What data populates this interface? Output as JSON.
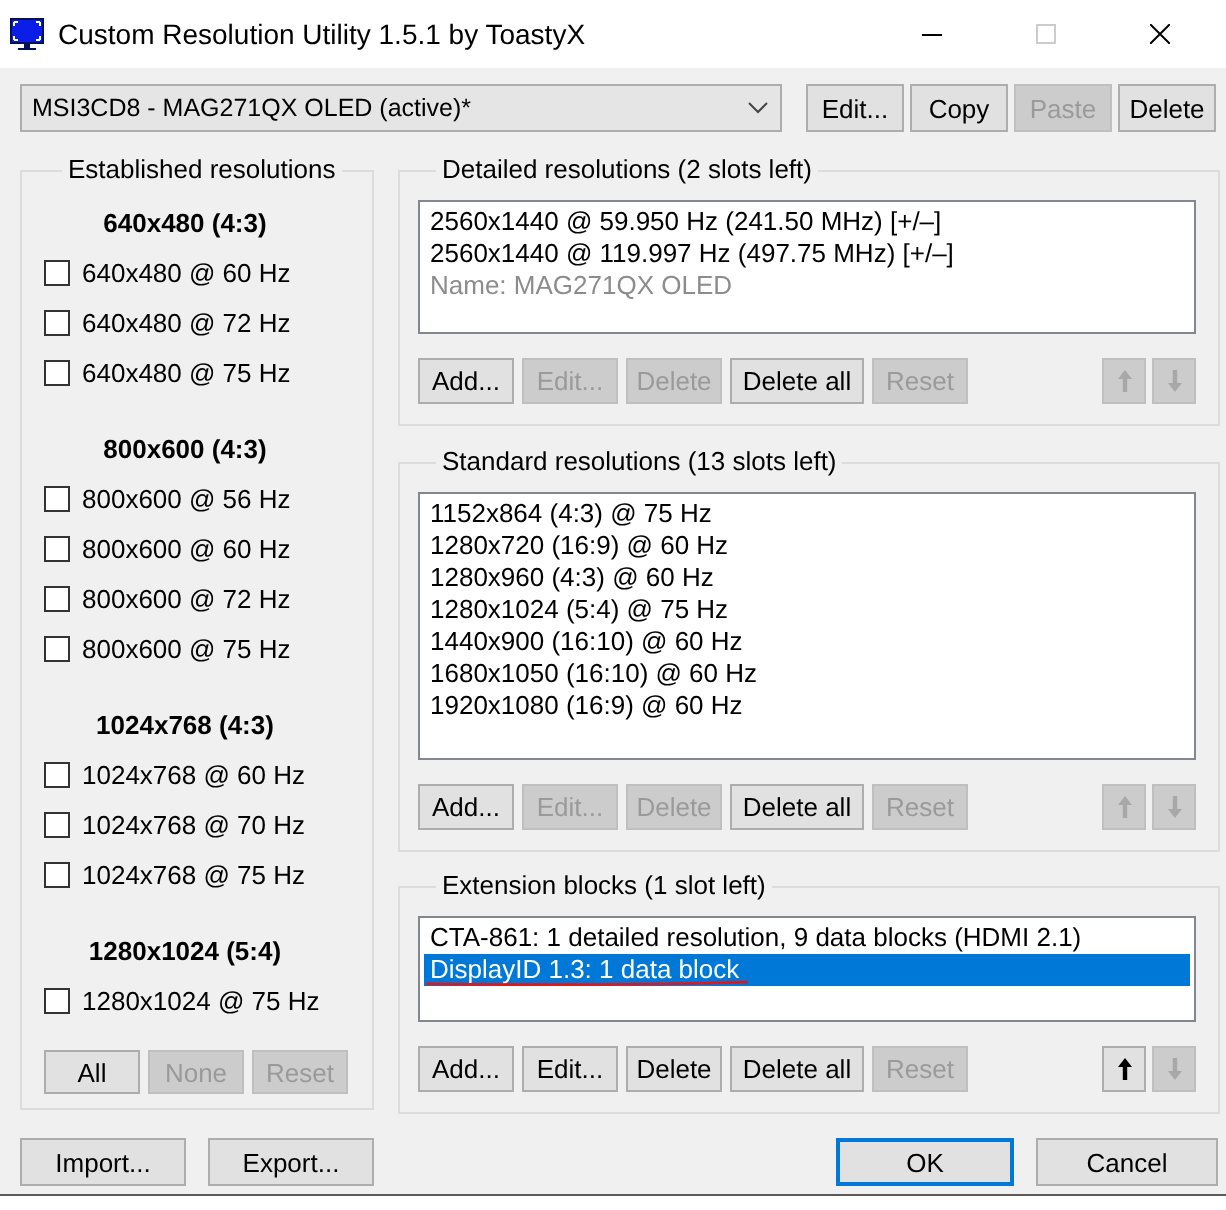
{
  "window": {
    "title": "Custom Resolution Utility 1.5.1 by ToastyX",
    "maximize_disabled": true
  },
  "toolbar": {
    "monitor_dropdown": {
      "value": "MSI3CD8 - MAG271QX OLED (active)*"
    },
    "buttons": [
      {
        "label": "Edit...",
        "disabled": false
      },
      {
        "label": "Copy",
        "disabled": false
      },
      {
        "label": "Paste",
        "disabled": true
      },
      {
        "label": "Delete",
        "disabled": false
      }
    ]
  },
  "established": {
    "title": "Established resolutions",
    "groups": [
      {
        "heading": "640x480 (4:3)",
        "items": [
          {
            "label": "640x480 @ 60 Hz",
            "checked": false
          },
          {
            "label": "640x480 @ 72 Hz",
            "checked": false
          },
          {
            "label": "640x480 @ 75 Hz",
            "checked": false
          }
        ]
      },
      {
        "heading": "800x600 (4:3)",
        "items": [
          {
            "label": "800x600 @ 56 Hz",
            "checked": false
          },
          {
            "label": "800x600 @ 60 Hz",
            "checked": false
          },
          {
            "label": "800x600 @ 72 Hz",
            "checked": false
          },
          {
            "label": "800x600 @ 75 Hz",
            "checked": false
          }
        ]
      },
      {
        "heading": "1024x768 (4:3)",
        "items": [
          {
            "label": "1024x768 @ 60 Hz",
            "checked": false
          },
          {
            "label": "1024x768 @ 70 Hz",
            "checked": false
          },
          {
            "label": "1024x768 @ 75 Hz",
            "checked": false
          }
        ]
      },
      {
        "heading": "1280x1024 (5:4)",
        "items": [
          {
            "label": "1280x1024 @ 75 Hz",
            "checked": false
          }
        ]
      }
    ],
    "buttons": [
      {
        "label": "All",
        "disabled": false
      },
      {
        "label": "None",
        "disabled": true
      },
      {
        "label": "Reset",
        "disabled": true
      }
    ]
  },
  "detailed": {
    "title": "Detailed resolutions (2 slots left)",
    "items": [
      {
        "kind": "timing",
        "text": "2560x1440 @ 59.950 Hz (241.50 MHz) [+/–]",
        "selected": false
      },
      {
        "kind": "timing",
        "text": "2560x1440 @ 119.997 Hz (497.75 MHz) [+/–]",
        "selected": false
      },
      {
        "kind": "name",
        "text": "Name: MAG271QX OLED",
        "selected": false
      }
    ],
    "buttons": [
      {
        "label": "Add...",
        "disabled": false
      },
      {
        "label": "Edit...",
        "disabled": true
      },
      {
        "label": "Delete",
        "disabled": true
      },
      {
        "label": "Delete all",
        "disabled": false
      },
      {
        "label": "Reset",
        "disabled": true
      }
    ],
    "arrows": [
      {
        "kind": "up",
        "disabled": true
      },
      {
        "kind": "down",
        "disabled": true
      }
    ]
  },
  "standard": {
    "title": "Standard resolutions (13 slots left)",
    "items": [
      {
        "kind": "timing",
        "text": "1152x864 (4:3) @ 75 Hz",
        "selected": false
      },
      {
        "kind": "timing",
        "text": "1280x720 (16:9) @ 60 Hz",
        "selected": false
      },
      {
        "kind": "timing",
        "text": "1280x960 (4:3) @ 60 Hz",
        "selected": false
      },
      {
        "kind": "timing",
        "text": "1280x1024 (5:4) @ 75 Hz",
        "selected": false
      },
      {
        "kind": "timing",
        "text": "1440x900 (16:10) @ 60 Hz",
        "selected": false
      },
      {
        "kind": "timing",
        "text": "1680x1050 (16:10) @ 60 Hz",
        "selected": false
      },
      {
        "kind": "timing",
        "text": "1920x1080 (16:9) @ 60 Hz",
        "selected": false
      }
    ],
    "buttons": [
      {
        "label": "Add...",
        "disabled": false
      },
      {
        "label": "Edit...",
        "disabled": true
      },
      {
        "label": "Delete",
        "disabled": true
      },
      {
        "label": "Delete all",
        "disabled": false
      },
      {
        "label": "Reset",
        "disabled": true
      }
    ],
    "arrows": [
      {
        "kind": "up",
        "disabled": true
      },
      {
        "kind": "down",
        "disabled": true
      }
    ]
  },
  "extension": {
    "title": "Extension blocks (1 slot left)",
    "items": [
      {
        "kind": "block",
        "text": "CTA-861: 1 detailed resolution, 9 data blocks (HDMI 2.1)",
        "selected": false,
        "underlined": false
      },
      {
        "kind": "block",
        "text": "DisplayID 1.3: 1 data block",
        "selected": true,
        "underlined": true
      }
    ],
    "buttons": [
      {
        "label": "Add...",
        "disabled": false
      },
      {
        "label": "Edit...",
        "disabled": false
      },
      {
        "label": "Delete",
        "disabled": false
      },
      {
        "label": "Delete all",
        "disabled": false
      },
      {
        "label": "Reset",
        "disabled": true
      }
    ],
    "arrows": [
      {
        "kind": "up",
        "disabled": false
      },
      {
        "kind": "down",
        "disabled": true
      }
    ]
  },
  "footer": {
    "buttons": [
      {
        "label": "Import...",
        "disabled": false
      },
      {
        "label": "Export...",
        "disabled": false
      }
    ],
    "dialog_buttons": [
      {
        "label": "OK",
        "default": true
      },
      {
        "label": "Cancel",
        "default": false
      }
    ]
  }
}
